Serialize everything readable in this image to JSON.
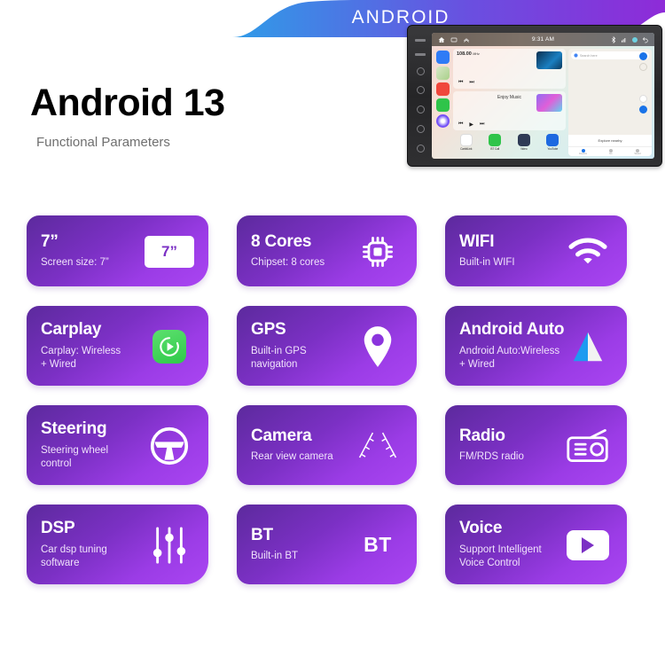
{
  "banner": {
    "label": "ANDROID",
    "gradient_from": "#2f9ce8",
    "gradient_to": "#8e2bd8"
  },
  "header": {
    "title": "Android 13",
    "subtitle": "Functional Parameters"
  },
  "device": {
    "name": "car-stereo-head-unit",
    "status_time": "9:31 AM",
    "map": {
      "search_placeholder": "Search here",
      "explore_label": "Explore nearby",
      "nav_items": [
        "Explore",
        "Go",
        "Saved"
      ]
    },
    "media": {
      "radio_frequency": "108.00",
      "radio_unit": "MHz",
      "now_playing": "Enjoy Music"
    },
    "apps": [
      "CarbitLink",
      "BT Call",
      "Video",
      "YouTube"
    ]
  },
  "features": [
    [
      {
        "title": "7”",
        "desc": "Screen size: 7”",
        "icon": "screen-size-icon",
        "icon_label": "7”"
      },
      {
        "title": "8 Cores",
        "desc": "Chipset: 8 cores",
        "icon": "cpu-chip-icon",
        "icon_label": ""
      },
      {
        "title": "WIFI",
        "desc": "Built-in WIFI",
        "icon": "wifi-icon",
        "icon_label": ""
      }
    ],
    [
      {
        "title": "Carplay",
        "desc": "Carplay: Wireless\n+ Wired",
        "icon": "carplay-icon",
        "icon_label": ""
      },
      {
        "title": "GPS",
        "desc": "Built-in GPS\nnavigation",
        "icon": "location-pin-icon",
        "icon_label": ""
      },
      {
        "title": "Android Auto",
        "desc": "Android Auto:Wireless\n+ Wired",
        "icon": "android-auto-icon",
        "icon_label": ""
      }
    ],
    [
      {
        "title": "Steering",
        "desc": "Steering wheel\ncontrol",
        "icon": "steering-wheel-icon",
        "icon_label": ""
      },
      {
        "title": "Camera",
        "desc": "Rear view camera",
        "icon": "parking-guideline-icon",
        "icon_label": ""
      },
      {
        "title": "Radio",
        "desc": "FM/RDS radio",
        "icon": "radio-icon",
        "icon_label": ""
      }
    ],
    [
      {
        "title": "DSP",
        "desc": "Car dsp tuning\nsoftware",
        "icon": "equalizer-sliders-icon",
        "icon_label": ""
      },
      {
        "title": "BT",
        "desc": "Built-in BT",
        "icon": "bluetooth-text-icon",
        "icon_label": "BT"
      },
      {
        "title": "Voice",
        "desc": "Support Intelligent\nVoice Control",
        "icon": "play-button-icon",
        "icon_label": ""
      }
    ]
  ],
  "colors": {
    "card_gradient_start": "#5c2a9d",
    "card_gradient_end": "#aa45f2",
    "title_text": "#ffffff",
    "desc_text": "#f0e2fb",
    "heading_text": "#000000",
    "subheading_text": "#6f6f6f",
    "carplay_green": "#2ec94a",
    "android_auto_blue": "#1e9bf0"
  }
}
